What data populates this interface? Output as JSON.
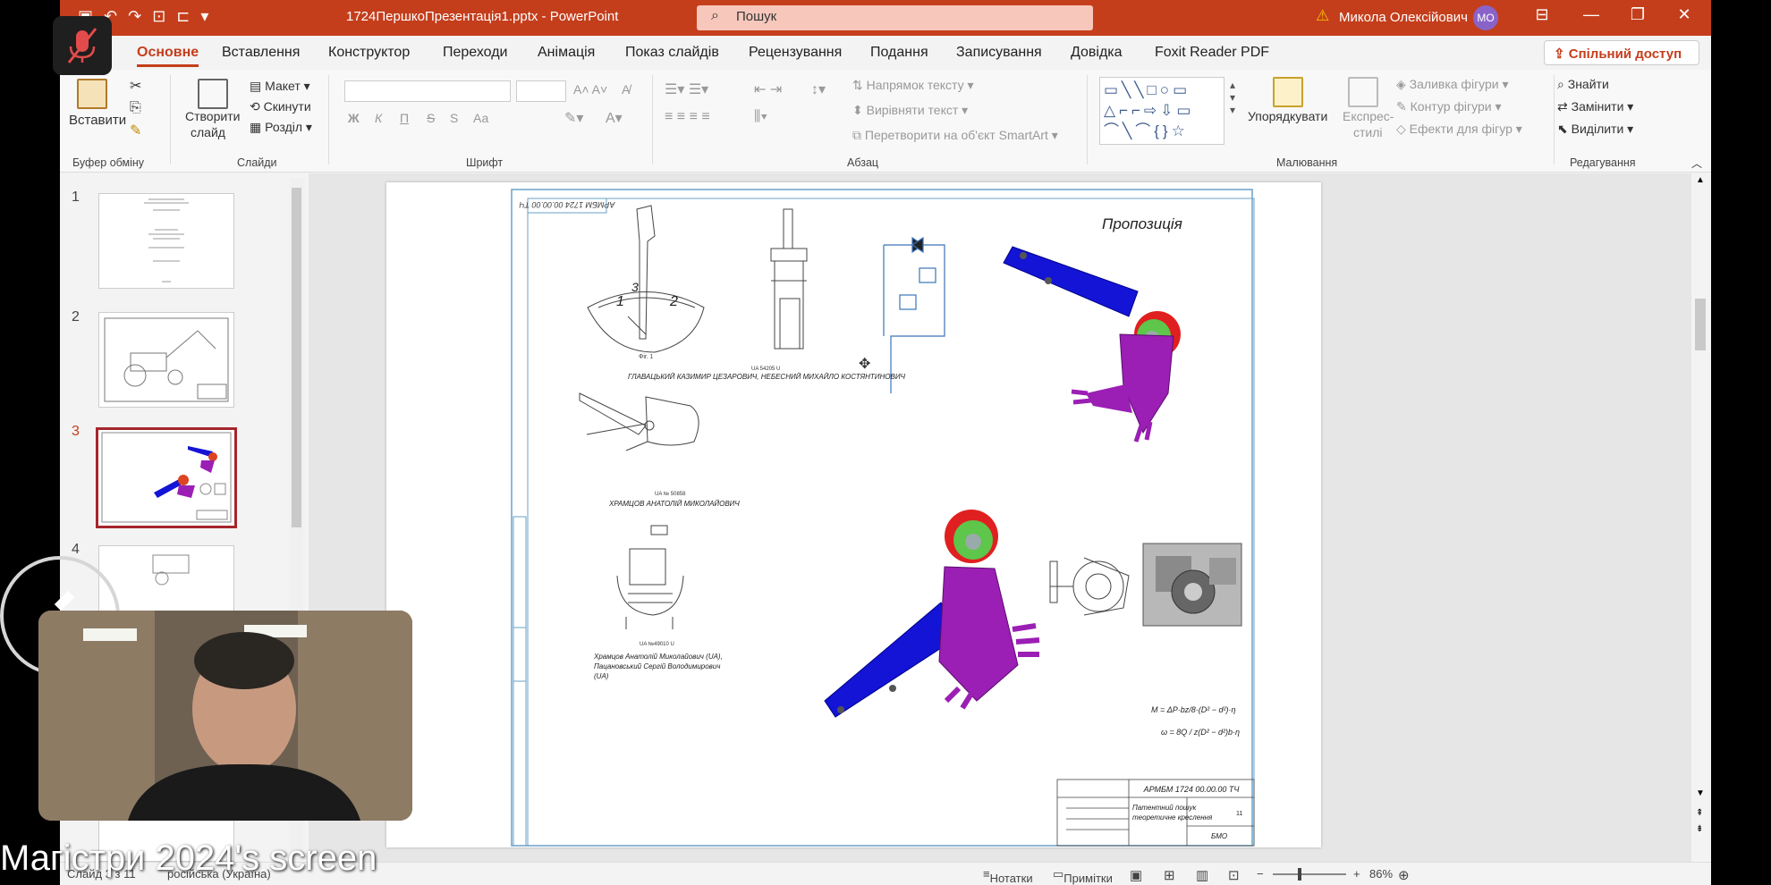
{
  "titlebar": {
    "document_title": "1724ПершкоПрезентація1.pptx  -  PowerPoint",
    "search_placeholder": "Пошук",
    "user_name": "Микола Олексійович",
    "avatar_initials": "МО",
    "accent_color": "#c43e1c"
  },
  "menu": {
    "tabs": [
      "Основне",
      "Вставлення",
      "Конструктор",
      "Переходи",
      "Анімація",
      "Показ слайдів",
      "Рецензування",
      "Подання",
      "Записування",
      "Довідка",
      "Foxit Reader PDF"
    ],
    "active_tab": "Основне",
    "share_label": "Спільний доступ"
  },
  "ribbon": {
    "clipboard": {
      "paste": "Вставити",
      "label": "Буфер обміну"
    },
    "slides": {
      "new_slide_line1": "Створити",
      "new_slide_line2": "слайд",
      "layout": "Макет",
      "reset": "Скинути",
      "section": "Розділ",
      "label": "Слайди"
    },
    "font": {
      "bold": "Ж",
      "italic": "К",
      "underline": "П",
      "strike": "S",
      "aa": "Аа",
      "label": "Шрифт"
    },
    "paragraph": {
      "text_direction": "Напрямок тексту",
      "align_text": "Вирівняти текст",
      "smartart": "Перетворити на об'єкт SmartArt",
      "label": "Абзац"
    },
    "drawing": {
      "arrange": "Упорядкувати",
      "quick_styles_line1": "Експрес-",
      "quick_styles_line2": "стилі",
      "fill": "Заливка фігури",
      "outline": "Контур фігури",
      "effects": "Ефекти для фігур",
      "label": "Малювання"
    },
    "editing": {
      "find": "Знайти",
      "replace": "Замінити",
      "select": "Виділити",
      "label": "Редагування"
    }
  },
  "thumbnails": [
    {
      "number": "1"
    },
    {
      "number": "2"
    },
    {
      "number": "3",
      "active": true
    },
    {
      "number": "4"
    }
  ],
  "slide": {
    "title": "Пропозиція",
    "stamp": "АРМБМ 1724 00.00.00 ТЧ",
    "patent1_number": "UA 54205 U",
    "patent1_authors": "ГЛАВАЦЬКИЙ КАЗИМИР ЦЕЗАРОВИЧ, НЕБЕСНИЙ МИХАЙЛО КОСТЯНТИНОВИЧ",
    "patent2_number": "UA № 50858",
    "patent2_authors": "ХРАМЦОВ АНАТОЛІЙ МИКОЛАЙОВИЧ",
    "patent3_number": "UA №49010 U",
    "patent3_authors_1": "Храмцов Анатолій Миколайович (UA),",
    "patent3_authors_2": "Пацановський Сергій Володимирович",
    "patent3_authors_3": "(UA)",
    "fig_label": "Фіг. 1",
    "formula1": "M = ΔP·bz/8·(D² − d²)·η",
    "formula2": "ω = 8Q / z(D² − d²)b·η",
    "titleblock_code": "АРМБМ 1724 00.00.00 ТЧ",
    "titleblock_name_1": "Патентний пошук",
    "titleblock_name_2": "теоретичне креслення",
    "titleblock_org": "БМО",
    "titleblock_sheets": "11"
  },
  "statusbar": {
    "slide_info": "Слайд 3 з 11",
    "language": "російська (Україна)",
    "notes": "Нотатки",
    "comments": "Примітки",
    "zoom": "86%"
  },
  "overlay": {
    "screen_label": "Магістри 2024's screen"
  }
}
